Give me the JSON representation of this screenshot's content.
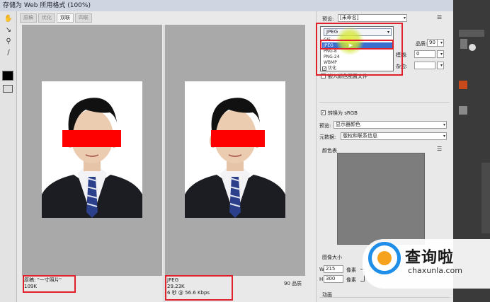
{
  "window": {
    "title": "存储为 Web 所用格式 (100%)"
  },
  "tabs": [
    {
      "label": "原稿",
      "active": false
    },
    {
      "label": "优化",
      "active": false
    },
    {
      "label": "双联",
      "active": true
    },
    {
      "label": "四联",
      "active": false
    }
  ],
  "tools": {
    "icons": [
      "hand-icon",
      "slice-select-icon",
      "zoom-icon",
      "eyedropper-icon"
    ],
    "swatch_color": "#000000"
  },
  "preview": {
    "original": {
      "line1": "原稿: \"一寸照片\"",
      "line2": "109K"
    },
    "optimized": {
      "line1": "JPEG",
      "line2": "29.23K",
      "line3": "6 秒 @ 56.6 Kbps",
      "quality": "90 品质"
    }
  },
  "settings": {
    "preset_label": "预设:",
    "preset_value": "[未命名]",
    "format_value": "JPEG",
    "format_options": [
      "GIF",
      "JPEG",
      "PNG-8",
      "PNG-24",
      "WBMP"
    ],
    "selected_format": "JPEG",
    "quality_label": "品质:",
    "quality_value": "90",
    "blur_label": "模糊:",
    "blur_value": "0",
    "matte_label": "杂边:",
    "optimized_label": "优化",
    "optimized_checked": true,
    "embed_profile_label": "嵌入颜色配置文件",
    "convert_srgb_label": "转换为 sRGB",
    "convert_srgb_checked": true,
    "preview_label": "预览:",
    "preview_value": "显示器颜色",
    "metadata_label": "元数据:",
    "metadata_value": "版权和联系信息",
    "color_table_label": "颜色表",
    "image_size_label": "图像大小",
    "width_label": "W:",
    "width_value": "215",
    "height_label": "H:",
    "height_value": "300",
    "unit": "像素",
    "animation_label": "动画"
  },
  "watermark": {
    "text": "查询啦",
    "url": "chaxunla.com"
  },
  "colors": {
    "highlight": "#e0202a",
    "accent": "#3a6fcf",
    "cursor": "#e2f03c"
  }
}
